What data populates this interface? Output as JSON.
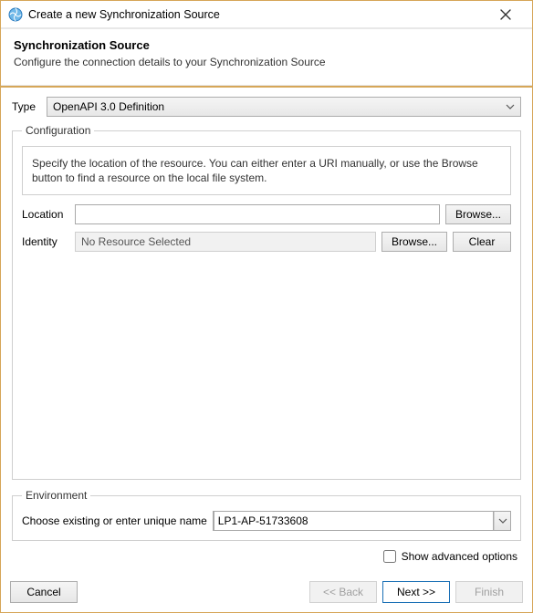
{
  "window": {
    "title": "Create a new Synchronization Source"
  },
  "banner": {
    "heading": "Synchronization Source",
    "description": "Configure the connection details to your Synchronization Source"
  },
  "type": {
    "label": "Type",
    "selected": "OpenAPI 3.0 Definition"
  },
  "config": {
    "legend": "Configuration",
    "info": "Specify the location of the resource.  You can either enter a URI manually, or use the Browse button to find a resource on the local file system.",
    "location": {
      "label": "Location",
      "value": "",
      "browse_label": "Browse..."
    },
    "identity": {
      "label": "Identity",
      "display": "No Resource Selected",
      "browse_label": "Browse...",
      "clear_label": "Clear"
    }
  },
  "env": {
    "legend": "Environment",
    "prompt": "Choose existing or enter unique name",
    "value": "LP1-AP-51733608"
  },
  "advanced": {
    "label": "Show advanced options",
    "checked": false
  },
  "buttons": {
    "cancel": "Cancel",
    "back": "<< Back",
    "next": "Next >>",
    "finish": "Finish"
  }
}
